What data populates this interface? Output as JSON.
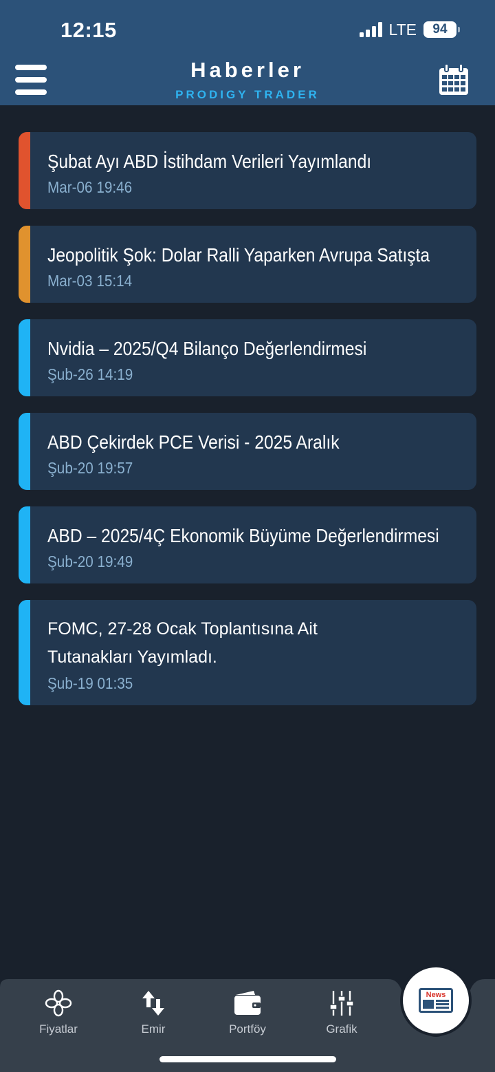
{
  "status_bar": {
    "time": "12:15",
    "network": "LTE",
    "battery": "94"
  },
  "header": {
    "title": "Haberler",
    "subtitle": "PRODIGY TRADER",
    "menu_icon": "hamburger-menu-icon",
    "calendar_icon": "calendar-icon"
  },
  "news": [
    {
      "title": "Şubat Ayı ABD İstihdam Verileri Yayımlandı",
      "date": "Mar-06 19:46",
      "accent": "#e0532e"
    },
    {
      "title": "Jeopolitik Şok: Dolar Ralli Yaparken Avrupa Satışta",
      "date": "Mar-03 15:14",
      "accent": "#e0922e"
    },
    {
      "title": "Nvidia – 2025/Q4 Bilanço Değerlendirmesi",
      "date": "Şub-26 14:19",
      "accent": "#1fb3f5"
    },
    {
      "title": "ABD Çekirdek PCE Verisi - 2025 Aralık",
      "date": "Şub-20 19:57",
      "accent": "#1fb3f5"
    },
    {
      "title": "ABD – 2025/4Ç Ekonomik Büyüme Değerlendirmesi",
      "date": "Şub-20 19:49",
      "accent": "#1fb3f5"
    },
    {
      "title": "FOMC, 27-28 Ocak Toplantısına Ait Tutanakları Yayımladı.",
      "date": "Şub-19 01:35",
      "accent": "#1fb3f5"
    }
  ],
  "bottom_nav": {
    "tabs": [
      {
        "label": "Fiyatlar",
        "icon": "prices-icon"
      },
      {
        "label": "Emir",
        "icon": "order-arrows-icon"
      },
      {
        "label": "Portföy",
        "icon": "wallet-icon"
      },
      {
        "label": "Grafik",
        "icon": "chart-sliders-icon"
      }
    ],
    "active": {
      "label": "News",
      "icon": "news-icon"
    }
  },
  "colors": {
    "header_bg": "#2c5279",
    "page_bg": "#19212c",
    "card_bg": "#22374f",
    "brand": "#2fb3f0",
    "nav_bg": "#36404b"
  }
}
